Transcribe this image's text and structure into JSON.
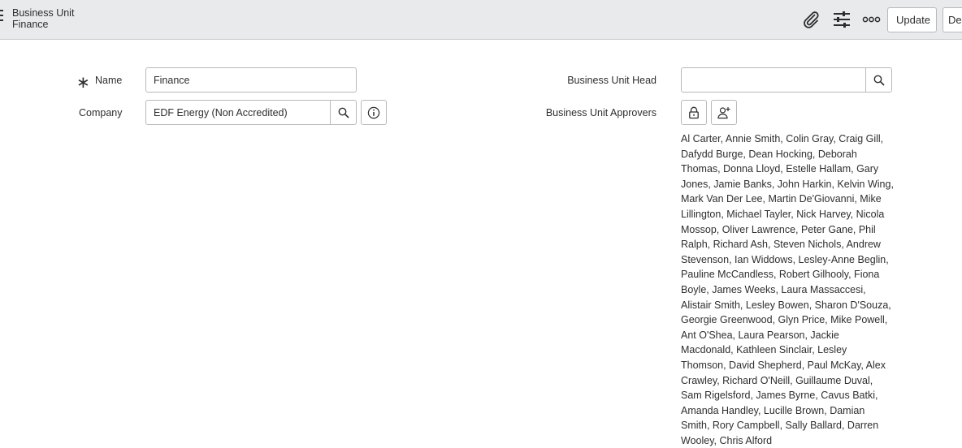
{
  "header": {
    "title": "Business Unit",
    "subtitle": "Finance",
    "icons": [
      "paperclip-icon",
      "sliders-icon",
      "more-options-icon"
    ],
    "update_label": "Update",
    "delete_label": "De"
  },
  "form": {
    "name_label": "Name",
    "name_value": "Finance",
    "company_label": "Company",
    "company_value": "EDF Energy (Non Accredited)",
    "bu_head_label": "Business Unit Head",
    "bu_head_value": "",
    "approvers_label": "Business Unit Approvers",
    "approvers_value": "Al Carter, Annie Smith, Colin Gray, Craig Gill, Dafydd Burge, Dean Hocking, Deborah Thomas, Donna Lloyd, Estelle Hallam, Gary Jones, Jamie Banks, John Harkin, Kelvin Wing, Mark Van Der Lee, Martin De'Giovanni, Mike Lillington, Michael Tayler, Nick Harvey, Nicola Mossop, Oliver Lawrence, Peter Gane, Phil Ralph, Richard Ash, Steven Nichols, Andrew Stevenson, Ian Widdows, Lesley-Anne Beglin, Pauline McCandless, Robert Gilhooly, Fiona Boyle, James Weeks, Laura Massaccesi, Alistair Smith, Lesley Bowen, Sharon D'Souza, Georgie Greenwood, Glyn Price, Mike Powell, Ant O'Shea, Laura Pearson, Jackie Macdonald, Kathleen Sinclair, Lesley Thomson, David Shepherd, Paul McKay, Alex Crawley, Richard O'Neill, Guillaume Duval, Sam Rigelsford, James Byrne, Cavus Batki, Amanda Handley, Lucille Brown, Damian Smith, Rory Campbell, Sally Ballard, Darren Wooley, Chris Alford"
  }
}
